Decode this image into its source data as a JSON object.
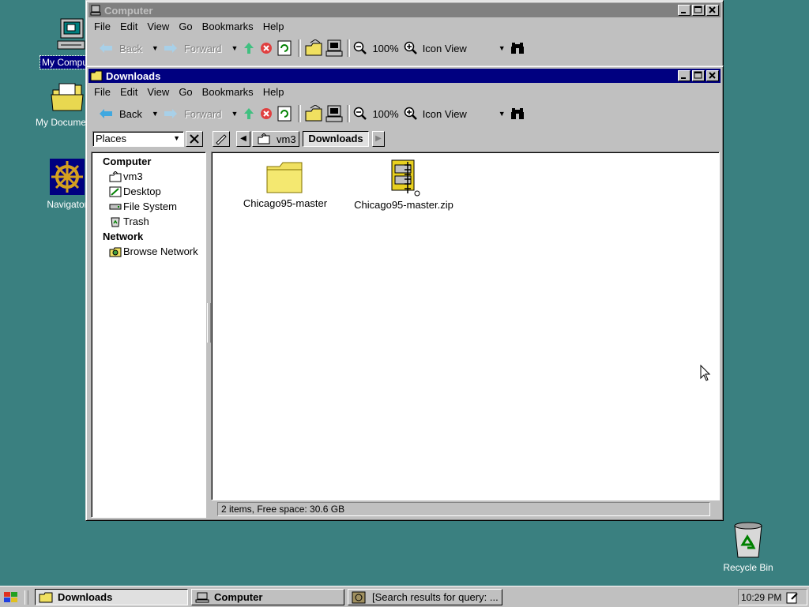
{
  "desktop": {
    "icons": [
      {
        "label": "My Computer"
      },
      {
        "label": "My Documents"
      },
      {
        "label": "Navigator"
      },
      {
        "label": "Recycle Bin"
      }
    ]
  },
  "back_window": {
    "title": "Computer",
    "menu": [
      "File",
      "Edit",
      "View",
      "Go",
      "Bookmarks",
      "Help"
    ],
    "toolbar": {
      "back": "Back",
      "forward": "Forward",
      "zoom": "100%",
      "view": "Icon View"
    }
  },
  "front_window": {
    "title": "Downloads",
    "menu": [
      "File",
      "Edit",
      "View",
      "Go",
      "Bookmarks",
      "Help"
    ],
    "toolbar": {
      "back": "Back",
      "forward": "Forward",
      "zoom": "100%",
      "view": "Icon View"
    },
    "sidebar_selector": "Places",
    "path": [
      "vm3",
      "Downloads"
    ],
    "sidebar": {
      "computer_heading": "Computer",
      "computer_items": [
        "vm3",
        "Desktop",
        "File System",
        "Trash"
      ],
      "network_heading": "Network",
      "network_items": [
        "Browse Network"
      ]
    },
    "files": [
      {
        "name": "Chicago95-master",
        "icon": "folder-icon"
      },
      {
        "name": "Chicago95-master.zip",
        "icon": "archive-icon"
      }
    ],
    "status": "2 items, Free space: 30.6 GB"
  },
  "taskbar": {
    "tasks": [
      {
        "label": "Downloads",
        "active": true
      },
      {
        "label": "Computer",
        "active": false
      },
      {
        "label": "[Search results for query: ...",
        "active": false
      }
    ],
    "clock": "10:29 PM"
  },
  "colors": {
    "desktop": "#3a8080",
    "active_title": "#000080",
    "inactive_title": "#808080",
    "face": "#c0c0c0"
  }
}
